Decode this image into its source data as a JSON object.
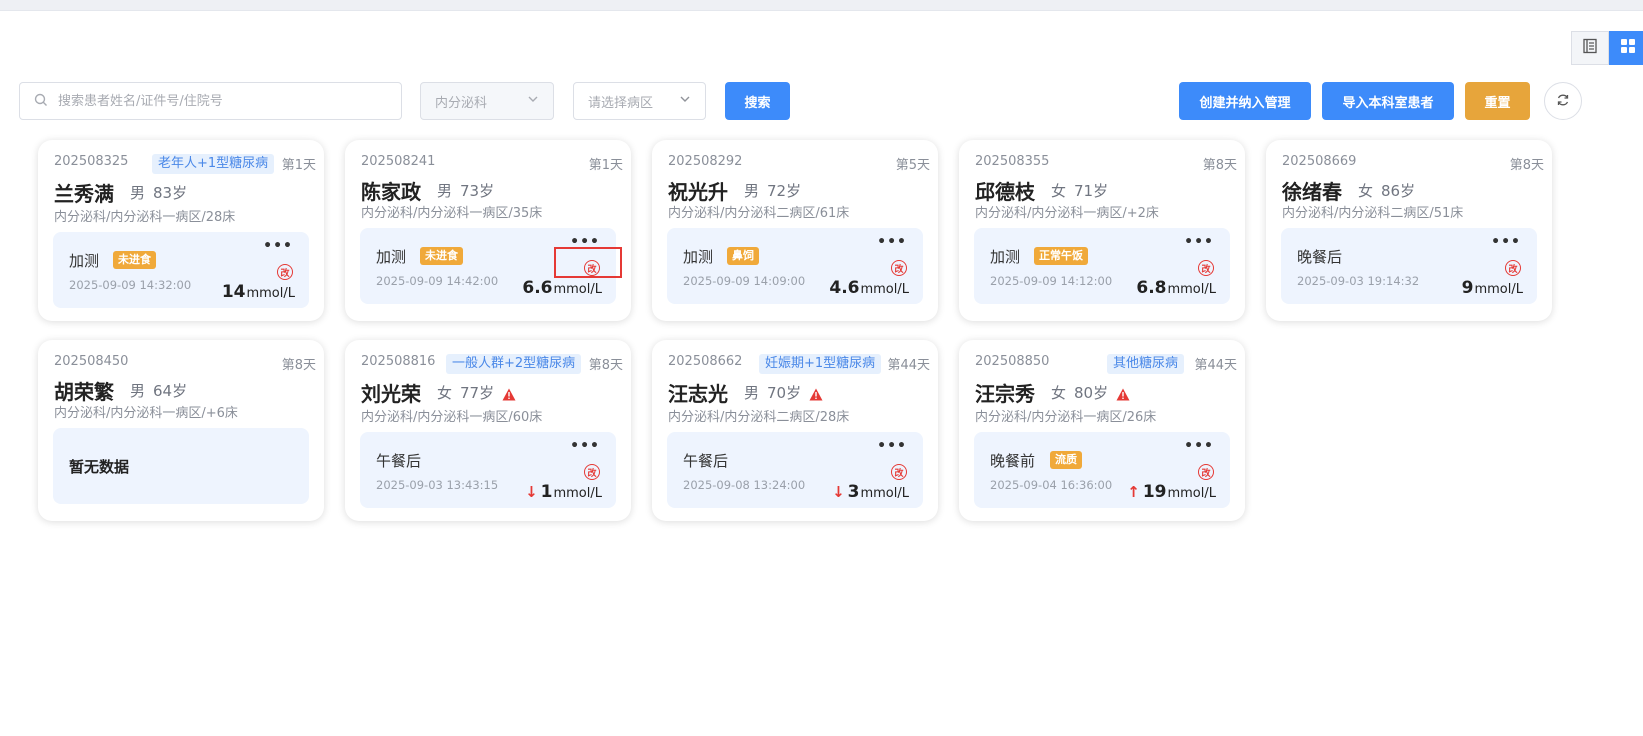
{
  "search": {
    "placeholder": "搜索患者姓名/证件号/住院号"
  },
  "filters": {
    "department": "内分泌科",
    "ward_placeholder": "请选择病区"
  },
  "buttons": {
    "search": "搜索",
    "create": "创建并纳入管理",
    "import": "导入本科室患者",
    "reset": "重置"
  },
  "icons": {
    "list_view": "list-icon",
    "grid_view": "grid-icon",
    "refresh": "refresh-icon",
    "search": "search-icon",
    "more": "more-icon",
    "edit": "edit-icon",
    "warning": "warning-icon"
  },
  "colors": {
    "primary": "#3d8bfa",
    "warning_badge": "#f0a93a",
    "alert": "#e53935",
    "tag_bg": "#e6f0fd"
  },
  "patients": [
    {
      "id": "202508325",
      "tag": "老年人+1型糖尿病",
      "day": "第1天",
      "name": "兰秀满",
      "gender": "男",
      "age": "83岁",
      "location": "内分泌科/内分泌科一病区/28床",
      "reading_label": "加测",
      "badge": "未进食",
      "time": "2025-09-09 14:32:00",
      "value": "14",
      "unit": "mmol/L"
    },
    {
      "id": "202508241",
      "tag": "",
      "day": "第1天",
      "name": "陈家政",
      "gender": "男",
      "age": "73岁",
      "location": "内分泌科/内分泌科一病区/35床",
      "reading_label": "加测",
      "badge": "未进食",
      "time": "2025-09-09 14:42:00",
      "value": "6.6",
      "unit": "mmol/L"
    },
    {
      "id": "202508292",
      "tag": "",
      "day": "第5天",
      "name": "祝光升",
      "gender": "男",
      "age": "72岁",
      "location": "内分泌科/内分泌科二病区/61床",
      "reading_label": "加测",
      "badge": "鼻饲",
      "time": "2025-09-09 14:09:00",
      "value": "4.6",
      "unit": "mmol/L"
    },
    {
      "id": "202508355",
      "tag": "",
      "day": "第8天",
      "name": "邱德枝",
      "gender": "女",
      "age": "71岁",
      "location": "内分泌科/内分泌科一病区/+2床",
      "reading_label": "加测",
      "badge": "正常午饭",
      "time": "2025-09-09 14:12:00",
      "value": "6.8",
      "unit": "mmol/L"
    },
    {
      "id": "202508669",
      "tag": "",
      "day": "第8天",
      "name": "徐绪春",
      "gender": "女",
      "age": "86岁",
      "location": "内分泌科/内分泌科二病区/51床",
      "reading_label": "晚餐后",
      "badge": "",
      "time": "2025-09-03 19:14:32",
      "value": "9",
      "unit": "mmol/L"
    },
    {
      "id": "202508450",
      "tag": "",
      "day": "第8天",
      "name": "胡荣繁",
      "gender": "男",
      "age": "64岁",
      "location": "内分泌科/内分泌科一病区/+6床",
      "no_data": "暂无数据"
    },
    {
      "id": "202508816",
      "tag": "一般人群+2型糖尿病",
      "day": "第8天",
      "name": "刘光荣",
      "gender": "女",
      "age": "77岁",
      "location": "内分泌科/内分泌科一病区/60床",
      "reading_label": "午餐后",
      "badge": "",
      "time": "2025-09-03 13:43:15",
      "value": "1",
      "unit": "mmol/L",
      "arrow": "↓"
    },
    {
      "id": "202508662",
      "tag": "妊娠期+1型糖尿病",
      "day": "第44天",
      "name": "汪志光",
      "gender": "男",
      "age": "70岁",
      "location": "内分泌科/内分泌科二病区/28床",
      "reading_label": "午餐后",
      "badge": "",
      "time": "2025-09-08 13:24:00",
      "value": "3",
      "unit": "mmol/L",
      "arrow": "↓"
    },
    {
      "id": "202508850",
      "tag": "其他糖尿病",
      "day": "第44天",
      "name": "汪宗秀",
      "gender": "女",
      "age": "80岁",
      "location": "内分泌科/内分泌科一病区/26床",
      "reading_label": "晚餐前",
      "badge": "流质",
      "time": "2025-09-04 16:36:00",
      "value": "19",
      "unit": "mmol/L",
      "arrow": "↑"
    }
  ]
}
